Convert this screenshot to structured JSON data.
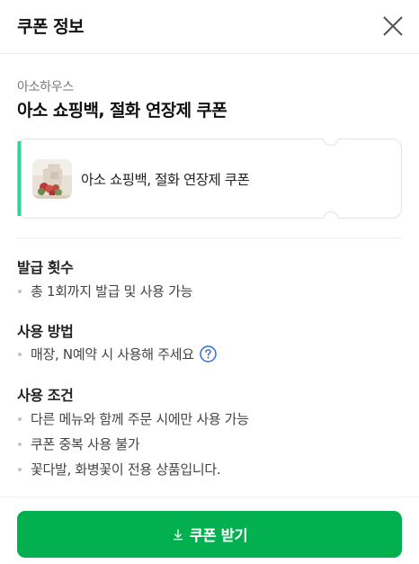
{
  "header": {
    "title": "쿠폰 정보",
    "close_icon": "close-icon"
  },
  "coupon": {
    "brand": "아소하우스",
    "title": "아소 쇼핑백, 절화 연장제 쿠폰",
    "card_name": "아소 쇼핑백, 절화 연장제 쿠폰",
    "accent_color": "#2ed39a"
  },
  "sections": {
    "issue": {
      "title": "발급 횟수",
      "items": [
        "총 1회까지 발급 및 사용 가능"
      ]
    },
    "usage": {
      "title": "사용 방법",
      "items": [
        "매장, N예약 시 사용해 주세요"
      ],
      "help_icon": "question-circle-icon"
    },
    "conditions": {
      "title": "사용 조건",
      "items": [
        "다른 메뉴와 함께 주문 시에만 사용 가능",
        "쿠폰 중복 사용 불가",
        "꽃다발, 화병꽃이 전용 상품입니다."
      ]
    }
  },
  "cta": {
    "label": "쿠폰 받기",
    "icon": "download-icon",
    "color": "#03b050"
  }
}
